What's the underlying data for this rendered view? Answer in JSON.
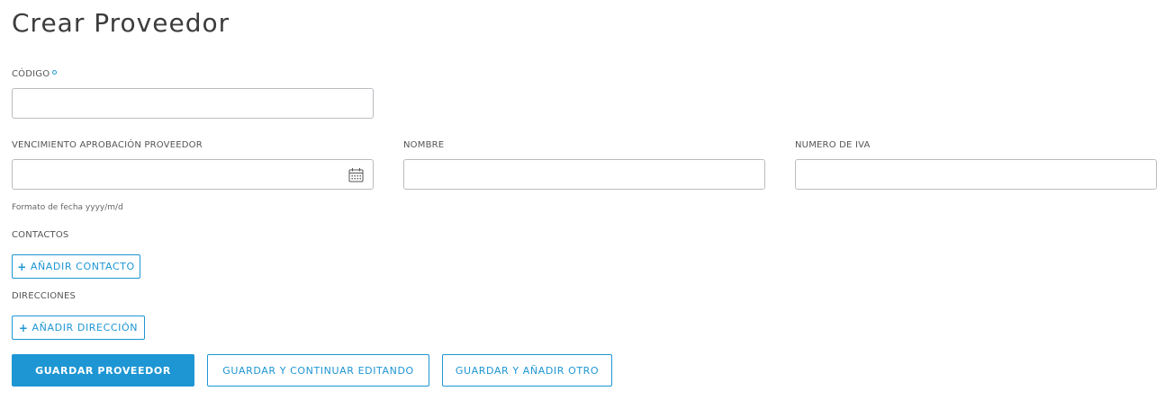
{
  "page": {
    "title": "Crear Proveedor"
  },
  "form": {
    "codigo": {
      "label": "CÓDIGO",
      "value": ""
    },
    "vencimiento": {
      "label": "VENCIMIENTO APROBACIÓN PROVEEDOR",
      "value": "",
      "hint": "Formato de fecha yyyy/m/d",
      "icon": "calendar-icon"
    },
    "nombre": {
      "label": "NOMBRE",
      "value": ""
    },
    "iva": {
      "label": "NUMERO DE IVA",
      "value": ""
    },
    "contactos": {
      "label": "CONTACTOS",
      "button": "AÑADIR CONTACTO",
      "icon": "plus-icon"
    },
    "direcciones": {
      "label": "DIRECCIONES",
      "button": "AÑADIR DIRECCIÓN",
      "icon": "plus-icon"
    }
  },
  "actions": {
    "save": "GUARDAR PROVEEDOR",
    "save_continue": "GUARDAR Y CONTINUAR EDITANDO",
    "save_add": "GUARDAR Y AÑADIR OTRO"
  },
  "colors": {
    "accent": "#1e96d3",
    "text": "#3c3c3c",
    "border": "#b9bcc0"
  }
}
